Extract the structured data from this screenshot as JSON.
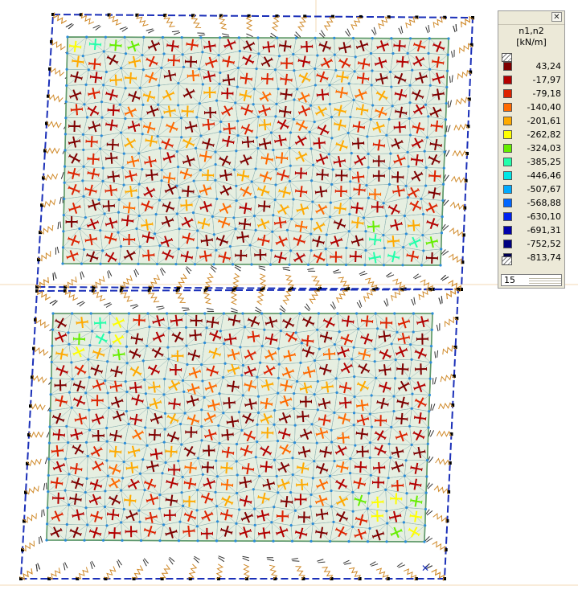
{
  "legend": {
    "title_line1": "n1,n2",
    "title_line2": "[kN/m]",
    "close_glyph": "✕",
    "entries": [
      {
        "value": "43,24",
        "color": "#7f0000"
      },
      {
        "value": "-17,97",
        "color": "#b30000"
      },
      {
        "value": "-79,18",
        "color": "#dd2200"
      },
      {
        "value": "-140,40",
        "color": "#ff6a00"
      },
      {
        "value": "-201,61",
        "color": "#ffaa00"
      },
      {
        "value": "-262,82",
        "color": "#ffff00"
      },
      {
        "value": "-324,03",
        "color": "#66ee00"
      },
      {
        "value": "-385,25",
        "color": "#22ffaa"
      },
      {
        "value": "-446,46",
        "color": "#00e6e6"
      },
      {
        "value": "-507,67",
        "color": "#00aaff"
      },
      {
        "value": "-568,88",
        "color": "#0066ff"
      },
      {
        "value": "-630,10",
        "color": "#0022ee"
      },
      {
        "value": "-691,31",
        "color": "#0000aa"
      },
      {
        "value": "-752,52",
        "color": "#000080"
      },
      {
        "value": "-813,74",
        "color": "#000050"
      }
    ],
    "color_count": "15"
  },
  "colors": {
    "frame": "#1a2fb8",
    "plate_fill": "#e6efe1",
    "plate_edge": "#2e7d2e",
    "mesh": "#8fb3b3",
    "node": "#2b8cd8",
    "spring": "#d08a2a",
    "support": "#000000"
  }
}
